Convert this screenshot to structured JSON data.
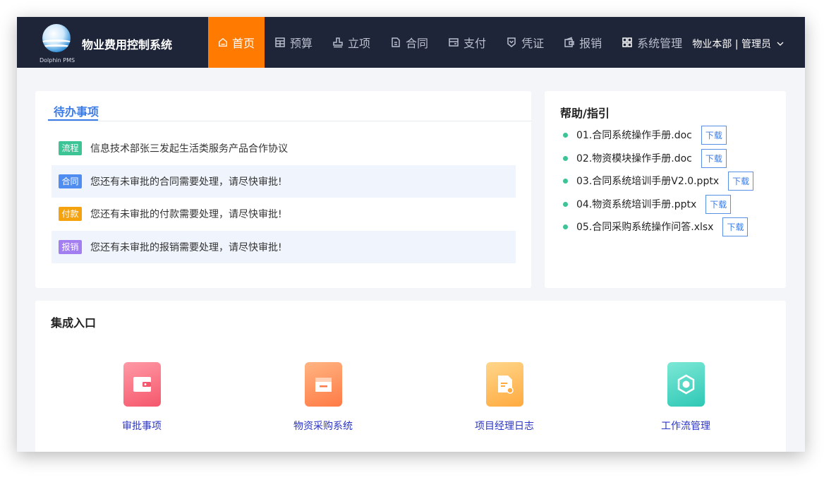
{
  "header": {
    "logo_text": "Dolphin PMS",
    "title": "物业费用控制系统",
    "nav": [
      {
        "label": "首页",
        "icon": "home-icon",
        "active": true
      },
      {
        "label": "预算",
        "icon": "calculator-icon",
        "active": false
      },
      {
        "label": "立项",
        "icon": "stamp-icon",
        "active": false
      },
      {
        "label": "合同",
        "icon": "document-icon",
        "active": false
      },
      {
        "label": "支付",
        "icon": "payment-icon",
        "active": false
      },
      {
        "label": "凭证",
        "icon": "voucher-icon",
        "active": false
      },
      {
        "label": "报销",
        "icon": "wallet-icon",
        "active": false
      },
      {
        "label": "系统管理",
        "icon": "grid-icon",
        "active": false
      }
    ],
    "user": "物业本部 | 管理员"
  },
  "todo": {
    "title": "待办事项",
    "items": [
      {
        "tag": "流程",
        "tag_color": "#3cc495",
        "text": "信息技术部张三发起生活类服务产品合作协议"
      },
      {
        "tag": "合同",
        "tag_color": "#4f8ef0",
        "text": "您还有未审批的合同需要处理，请尽快审批!"
      },
      {
        "tag": "付款",
        "tag_color": "#f5a20f",
        "text": "您还有未审批的付款需要处理，请尽快审批!"
      },
      {
        "tag": "报销",
        "tag_color": "#a37ef0",
        "text": "您还有未审批的报销需要处理，请尽快审批!"
      }
    ]
  },
  "help": {
    "title": "帮助/指引",
    "download_label": "下载",
    "items": [
      "01.合同系统操作手册.doc",
      "02.物资模块操作手册.doc",
      "03.合同系统培训手册V2.0.pptx",
      "04.物资系统培训手册.pptx",
      "05.合同采购系统操作问答.xlsx"
    ]
  },
  "portal": {
    "title": "集成入口",
    "entries": [
      {
        "label": "审批事项",
        "icon": "wallet-icon",
        "color_from": "#ff9a9e",
        "color_to": "#f5576c"
      },
      {
        "label": "物资采购系统",
        "icon": "box-icon",
        "color_from": "#ffb07a",
        "color_to": "#ff7a45"
      },
      {
        "label": "项目经理日志",
        "icon": "file-icon",
        "color_from": "#ffd27a",
        "color_to": "#ffa940"
      },
      {
        "label": "工作流管理",
        "icon": "workflow-icon",
        "color_from": "#7de8d6",
        "color_to": "#2ec8b5"
      }
    ]
  }
}
